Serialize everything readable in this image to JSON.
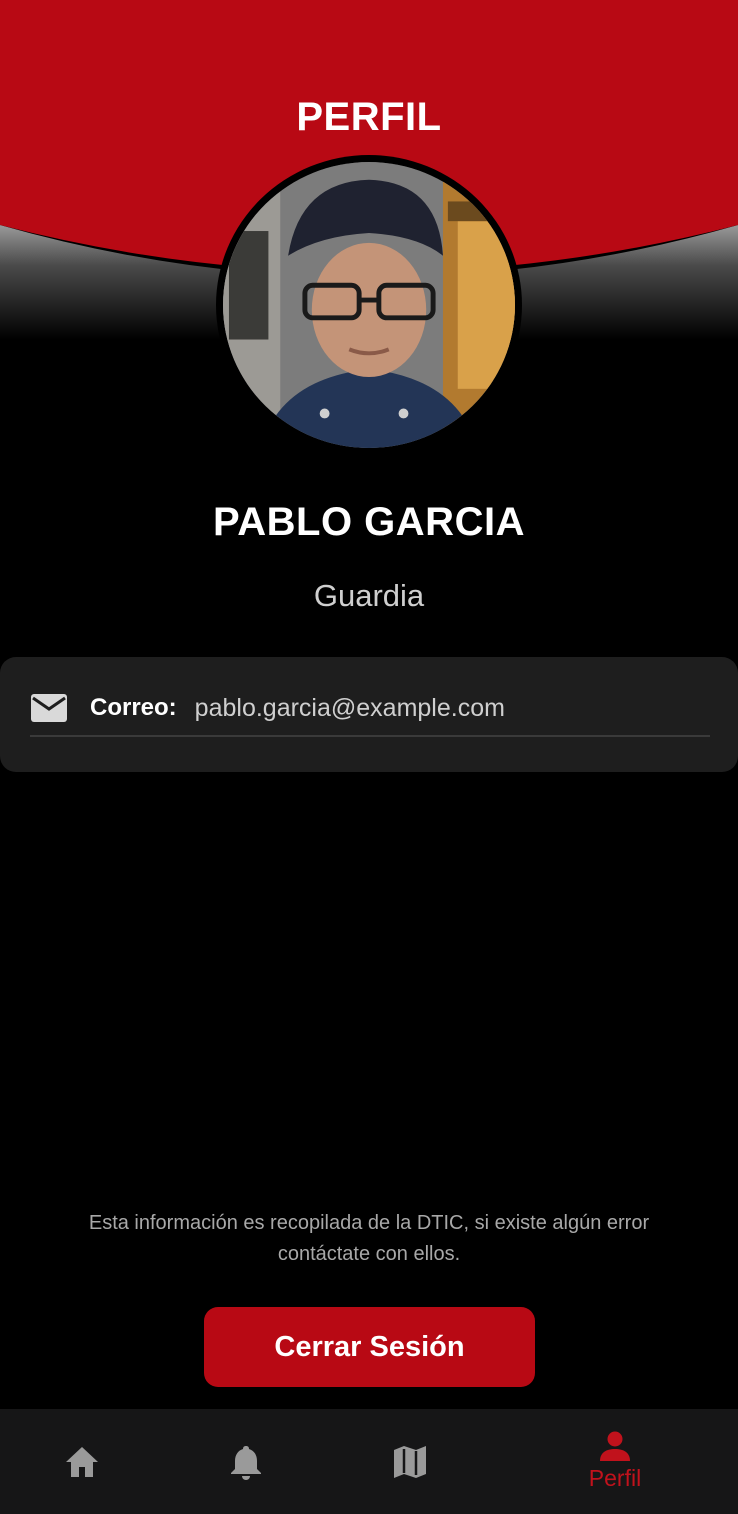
{
  "header": {
    "title": "PERFIL"
  },
  "user": {
    "name": "PABLO GARCIA",
    "role": "Guardia"
  },
  "info": {
    "email_label": "Correo:",
    "email_value": "pablo.garcia@example.com"
  },
  "disclaimer": "Esta información es recopilada de la DTIC, si existe algún error contáctate con ellos.",
  "logout_label": "Cerrar Sesión",
  "nav": {
    "items": [
      {
        "icon": "home-icon",
        "label": ""
      },
      {
        "icon": "bell-icon",
        "label": ""
      },
      {
        "icon": "map-icon",
        "label": ""
      },
      {
        "icon": "person-icon",
        "label": "Perfil",
        "active": true
      }
    ]
  },
  "colors": {
    "brand_red": "#b80914",
    "active_nav": "#c1121c",
    "background": "#000000",
    "card": "#1e1e1e"
  }
}
